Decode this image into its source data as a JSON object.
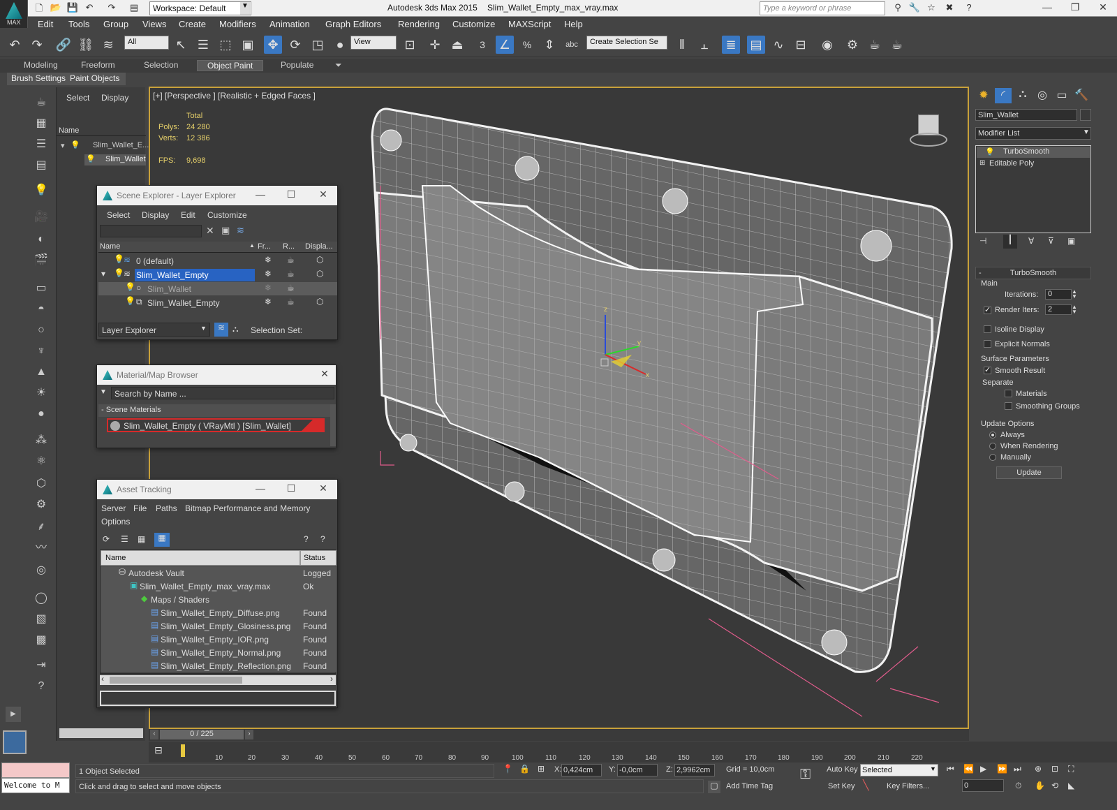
{
  "titlebar": {
    "workspace": "Workspace: Default",
    "app": "Autodesk 3ds Max  2015",
    "document": "Slim_Wallet_Empty_max_vray.max",
    "search_placeholder": "Type a keyword or phrase"
  },
  "logo": {
    "text": "MAX"
  },
  "menu": [
    "Edit",
    "Tools",
    "Group",
    "Views",
    "Create",
    "Modifiers",
    "Animation",
    "Graph Editors",
    "Rendering",
    "Customize",
    "MAXScript",
    "Help"
  ],
  "toolbar": {
    "filter": "All",
    "refcoord": "View",
    "selection_set": "Create Selection Se",
    "snap_label": "3"
  },
  "ribbon": {
    "tabs": [
      "Modeling",
      "Freeform",
      "Selection",
      "Object Paint",
      "Populate"
    ],
    "active": "Object Paint",
    "sub": [
      "Brush Settings",
      "Paint Objects"
    ]
  },
  "scene_panel": {
    "tabs": [
      "Select",
      "Display"
    ],
    "header": "Name",
    "items": [
      "Slim_Wallet_E...",
      "Slim_Wallet"
    ],
    "time": "0 / 225"
  },
  "viewport": {
    "label": "[+] [Perspective ] [Realistic + Edged Faces ]",
    "stats": {
      "total_label": "Total",
      "polys_label": "Polys:",
      "polys": "24 280",
      "verts_label": "Verts:",
      "verts": "12 386",
      "fps_label": "FPS:",
      "fps": "9,698"
    },
    "axes": {
      "x": "x",
      "y": "y",
      "z": "z"
    }
  },
  "layer_explorer": {
    "title": "Scene Explorer - Layer Explorer",
    "menu": [
      "Select",
      "Display",
      "Edit",
      "Customize"
    ],
    "cols": [
      "Name",
      "Fr...",
      "R...",
      "Displa..."
    ],
    "rows": [
      "0 (default)",
      "Slim_Wallet_Empty",
      "Slim_Wallet",
      "Slim_Wallet_Empty"
    ],
    "footer_mode": "Layer Explorer",
    "selection_set": "Selection Set:"
  },
  "material_browser": {
    "title": "Material/Map Browser",
    "search": "Search by Name ...",
    "group": "- Scene Materials",
    "item": "Slim_Wallet_Empty  ( VRayMtl ) [Slim_Wallet]"
  },
  "asset_tracking": {
    "title": "Asset Tracking",
    "menu": [
      "Server",
      "File",
      "Paths",
      "Bitmap Performance and Memory",
      "Options"
    ],
    "cols": [
      "Name",
      "Status"
    ],
    "rows": [
      {
        "name": "Autodesk Vault",
        "status": "Logged C"
      },
      {
        "name": "Slim_Wallet_Empty_max_vray.max",
        "status": "Ok"
      },
      {
        "name": "Maps / Shaders",
        "status": ""
      },
      {
        "name": "Slim_Wallet_Empty_Diffuse.png",
        "status": "Found"
      },
      {
        "name": "Slim_Wallet_Empty_Glosiness.png",
        "status": "Found"
      },
      {
        "name": "Slim_Wallet_Empty_IOR.png",
        "status": "Found"
      },
      {
        "name": "Slim_Wallet_Empty_Normal.png",
        "status": "Found"
      },
      {
        "name": "Slim_Wallet_Empty_Reflection.png",
        "status": "Found"
      }
    ]
  },
  "command_panel": {
    "object_name": "Slim_Wallet",
    "modifier_list": "Modifier List",
    "stack": [
      "TurboSmooth",
      "Editable Poly"
    ],
    "rollout": "TurboSmooth",
    "main": "Main",
    "iterations_label": "Iterations:",
    "iterations": "0",
    "render_iters_label": "Render Iters:",
    "render_iters": "2",
    "isoline": "Isoline Display",
    "explicit": "Explicit Normals",
    "surface": "Surface Parameters",
    "smooth_result": "Smooth Result",
    "separate": "Separate",
    "materials": "Materials",
    "smoothing_groups": "Smoothing Groups",
    "update_options": "Update Options",
    "always": "Always",
    "when_rendering": "When Rendering",
    "manually": "Manually",
    "update": "Update"
  },
  "timeline": {
    "ticks": [
      "10",
      "20",
      "30",
      "40",
      "50",
      "60",
      "70",
      "80",
      "90",
      "100",
      "110",
      "120",
      "130",
      "140",
      "150",
      "160",
      "170",
      "180",
      "190",
      "200",
      "210",
      "220"
    ]
  },
  "status": {
    "welcome": "Welcome to M",
    "selected": "1 Object Selected",
    "hint": "Click and drag to select and move objects",
    "x_label": "X:",
    "x": "0,424cm",
    "y_label": "Y:",
    "y": "-0,0cm",
    "z_label": "Z:",
    "z": "2,9962cm",
    "grid": "Grid = 10,0cm",
    "add_time_tag": "Add Time Tag",
    "auto_key": "Auto Key",
    "set_key": "Set Key",
    "selected_dd": "Selected",
    "key_filters": "Key Filters...",
    "frame": "0"
  },
  "colors": {
    "accent": "#3a78c3",
    "viewport_border": "#c8a13a",
    "stats": "#e6d06a"
  }
}
